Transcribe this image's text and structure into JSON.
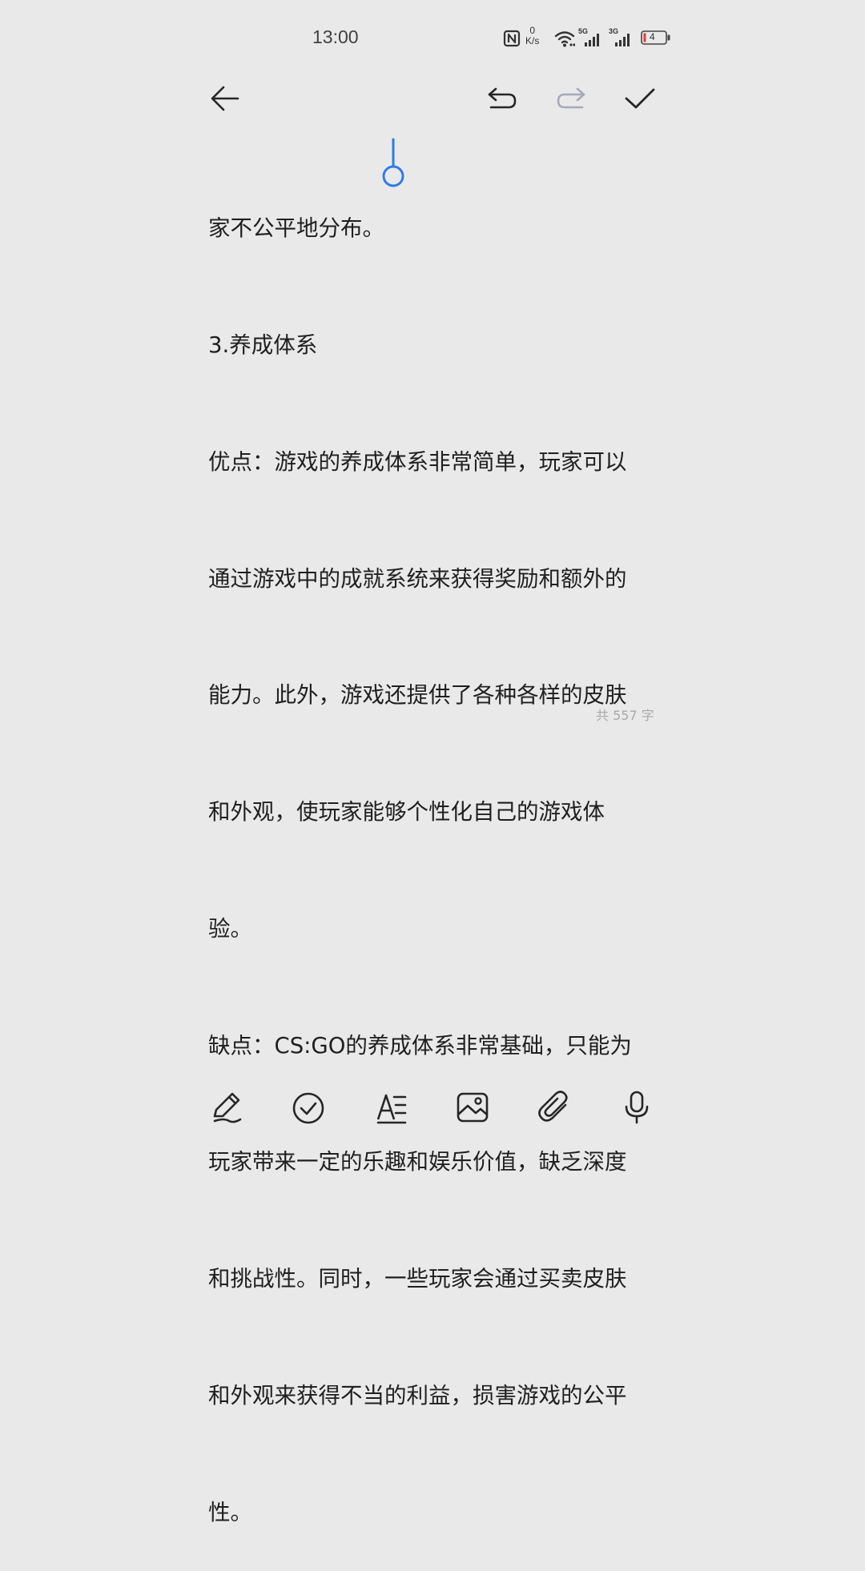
{
  "status_bar": {
    "time": "13:00",
    "net_speed_value": "0",
    "net_speed_unit": "K/s",
    "signal1_label": "5G",
    "signal2_label": "3G",
    "battery_level": "4",
    "icons": [
      "nfc-icon",
      "wifi-icon",
      "signal-5g-icon",
      "signal-3g-icon",
      "battery-icon"
    ]
  },
  "toolbar": {
    "icons": [
      "back-arrow-icon",
      "undo-icon",
      "redo-icon",
      "check-icon"
    ],
    "redo_enabled": false
  },
  "note": {
    "lines": [
      "家不公平地分布。",
      "3.养成体系",
      "优点：游戏的养成体系非常简单，玩家可以",
      "通过游戏中的成就系统来获得奖励和额外的",
      "能力。此外，游戏还提供了各种各样的皮肤",
      "和外观，使玩家能够个性化自己的游戏体",
      "验。",
      "缺点：CS:GO的养成体系非常基础，只能为",
      "玩家带来一定的乐趣和娱乐价值，缺乏深度",
      "和挑战性。同时，一些玩家会通过买卖皮肤",
      "和外观来获得不当的利益，损害游戏的公平",
      "性。"
    ]
  },
  "word_count": "共 557 字",
  "bottom_bar": {
    "icons": [
      "handwriting-pen-icon",
      "checklist-icon",
      "text-format-icon",
      "image-icon",
      "attachment-icon",
      "microphone-icon"
    ]
  },
  "colors": {
    "background": "#e9e9e9",
    "text": "#1f1f1f",
    "cursor_accent": "#2f7be6",
    "disabled_icon": "#a8a8bc",
    "word_count": "#a9a9a9"
  }
}
